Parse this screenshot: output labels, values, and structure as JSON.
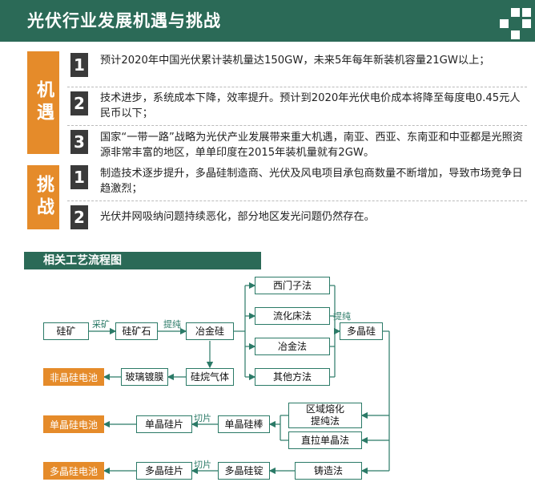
{
  "header": {
    "title": "光伏行业发展机遇与挑战"
  },
  "opportunities": {
    "label": "机遇",
    "items": [
      {
        "num": "1",
        "text": "预计2020年中国光伏累计装机量达150GW，未来5年每年新装机容量21GW以上；"
      },
      {
        "num": "2",
        "text": "技术进步，系统成本下降，效率提升。预计到2020年光伏电价成本将降至每度电0.45元人民币以下；"
      },
      {
        "num": "3",
        "text": "国家“一带一路”战略为光伏产业发展带来重大机遇，南亚、西亚、东南亚和中亚都是光照资源非常丰富的地区，单单印度在2015年装机量就有2GW。"
      }
    ]
  },
  "challenges": {
    "label": "挑战",
    "items": [
      {
        "num": "1",
        "text": "制造技术逐步提升，多晶硅制造商、光伏及风电项目承包商数量不断增加，导致市场竞争日趋激烈；"
      },
      {
        "num": "2",
        "text": "光伏并网吸纳问题持续恶化，部分地区发光问题仍然存在。"
      }
    ]
  },
  "process": {
    "title": "相关工艺流程图",
    "nodes": {
      "ore": "硅矿",
      "quartz": "硅矿石",
      "mg_si": "冶金硅",
      "siemens": "西门子法",
      "fbr": "流化床法",
      "metallurgy": "冶金法",
      "other": "其他方法",
      "poly": "多晶硅",
      "silane": "硅烷气体",
      "glass": "玻璃镀膜",
      "amorphous_cell": "非晶硅电池",
      "fz": "区域熔化提纯法",
      "cz": "直拉单晶法",
      "mono_rod": "单晶硅棒",
      "mono_wafer": "单晶硅片",
      "mono_cell": "单晶硅电池",
      "casting": "铸造法",
      "poly_ingot": "多晶硅锭",
      "poly_wafer": "多晶硅片",
      "poly_cell": "多晶硅电池"
    },
    "edges": {
      "mining": "采矿",
      "purify1": "提纯",
      "purify2": "提纯",
      "slice1": "切片",
      "slice2": "切片"
    }
  }
}
